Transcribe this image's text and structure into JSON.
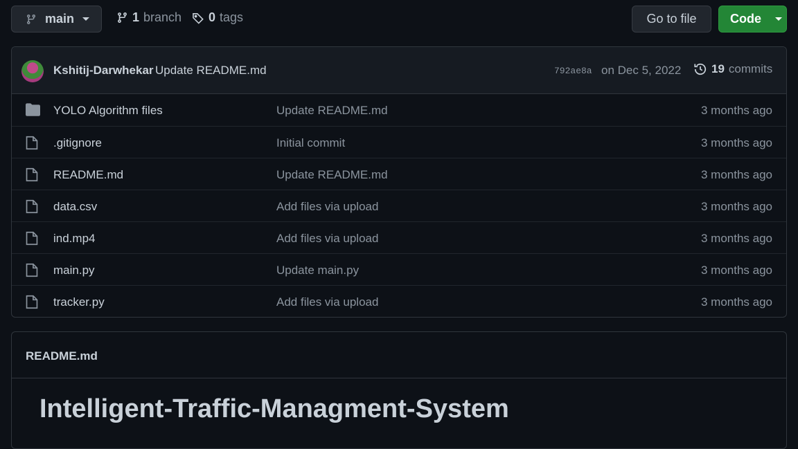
{
  "toolbar": {
    "branch_name": "main",
    "branch_count": "1",
    "branch_label": "branch",
    "tag_count": "0",
    "tag_label": "tags",
    "goto_file": "Go to file",
    "code": "Code"
  },
  "latest_commit": {
    "author": "Kshitij-Darwhekar",
    "message": "Update README.md",
    "sha": "792ae8a",
    "date": "on Dec 5, 2022",
    "commit_count": "19",
    "commit_label": "commits"
  },
  "files": [
    {
      "type": "folder",
      "name": "YOLO Algorithm files",
      "message": "Update README.md",
      "age": "3 months ago"
    },
    {
      "type": "file",
      "name": ".gitignore",
      "message": "Initial commit",
      "age": "3 months ago"
    },
    {
      "type": "file",
      "name": "README.md",
      "message": "Update README.md",
      "age": "3 months ago"
    },
    {
      "type": "file",
      "name": "data.csv",
      "message": "Add files via upload",
      "age": "3 months ago"
    },
    {
      "type": "file",
      "name": "ind.mp4",
      "message": "Add files via upload",
      "age": "3 months ago"
    },
    {
      "type": "file",
      "name": "main.py",
      "message": "Update main.py",
      "age": "3 months ago"
    },
    {
      "type": "file",
      "name": "tracker.py",
      "message": "Add files via upload",
      "age": "3 months ago"
    }
  ],
  "readme": {
    "filename": "README.md",
    "heading": "Intelligent-Traffic-Managment-System"
  },
  "colors": {
    "background": "#0d1117",
    "code_button": "#238636",
    "text": "#c9d1d9",
    "muted": "#8b949e"
  }
}
